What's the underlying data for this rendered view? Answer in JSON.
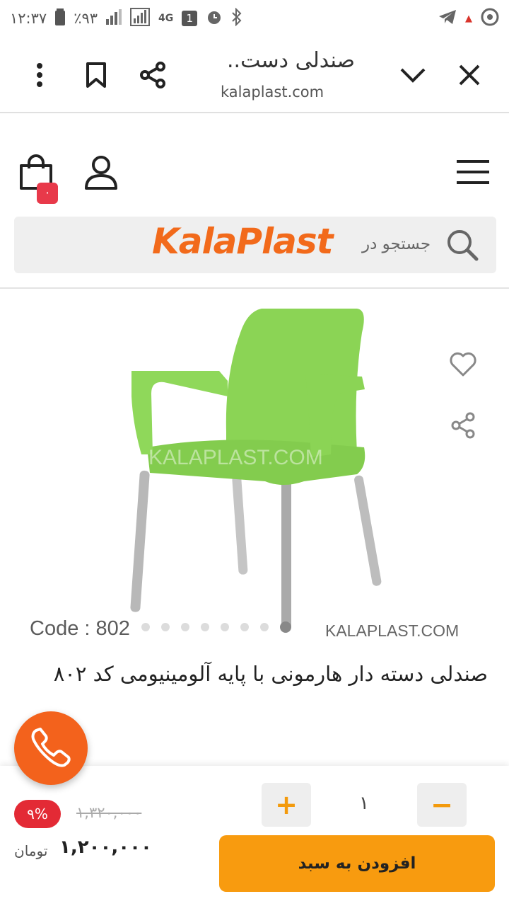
{
  "status_bar": {
    "time": "۱۲:۳۷",
    "battery": "٪۹۳",
    "network": "4G",
    "sim": "1"
  },
  "browser": {
    "title": "صندلی دست..",
    "url": "kalaplast.com"
  },
  "header": {
    "cart_count": "۰",
    "logo_text": "KalaPlast",
    "search_placeholder": "جستجو در"
  },
  "product": {
    "code_label": "Code : 802",
    "watermark": "KALAPLAST.COM",
    "title": "صندلی دسته دار هارمونی با پایه آلومینیومی کد ۸۰۲",
    "image_count": 8,
    "active_image": 8,
    "chair_color": "#8bd455"
  },
  "purchase": {
    "quantity": "۱",
    "discount": "۹%",
    "old_price": "۱,۳۲۰,۰۰۰",
    "price": "۱,۲۰۰,۰۰۰",
    "currency": "تومان",
    "add_to_cart_label": "افزودن به سبد"
  },
  "colors": {
    "accent": "#f89b0f",
    "brand": "#f26a1b",
    "discount": "#e32a35"
  }
}
